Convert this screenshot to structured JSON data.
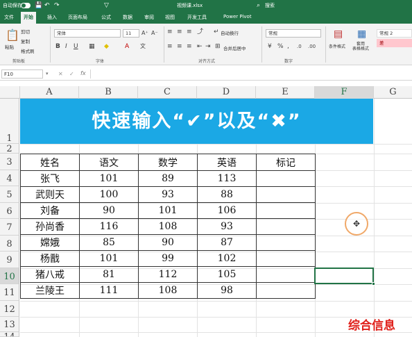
{
  "titlebar": {
    "autosave_label": "自动保存",
    "filename": "视频课.xlsx",
    "search_placeholder": "搜索"
  },
  "tabs": [
    "文件",
    "开始",
    "插入",
    "页面布局",
    "公式",
    "数据",
    "审阅",
    "视图",
    "开发工具",
    "Power Pivot"
  ],
  "active_tab": "开始",
  "ribbon": {
    "paste": "粘贴",
    "cut": "剪切",
    "copy": "复制",
    "format_painter": "格式刷",
    "font_name": "宋体",
    "font_size": "11",
    "wrap_text": "自动换行",
    "merge_center": "合并后居中",
    "number_format": "常规",
    "conditional_format": "条件格式",
    "table_format": "套用\n表格格式",
    "style_normal": "常规 2",
    "style_bad": "差",
    "groups": {
      "clipboard": "剪贴板",
      "font": "字体",
      "alignment": "对齐方式",
      "number": "数字"
    }
  },
  "formula_bar": {
    "name_box": "F10",
    "formula": ""
  },
  "columns": [
    "A",
    "B",
    "C",
    "D",
    "E",
    "F",
    "G"
  ],
  "rows": [
    "1",
    "2",
    "3",
    "4",
    "5",
    "6",
    "7",
    "8",
    "9",
    "10",
    "11",
    "12",
    "13",
    "14"
  ],
  "banner_text": "快速输入“✔”以及“✖”",
  "table": {
    "headers": [
      "姓名",
      "语文",
      "数学",
      "英语",
      "标记"
    ],
    "rows": [
      [
        "张飞",
        "101",
        "89",
        "113",
        ""
      ],
      [
        "武则天",
        "100",
        "93",
        "88",
        ""
      ],
      [
        "刘备",
        "90",
        "101",
        "106",
        ""
      ],
      [
        "孙尚香",
        "116",
        "108",
        "93",
        ""
      ],
      [
        "嫦娥",
        "85",
        "90",
        "87",
        ""
      ],
      [
        "杨戬",
        "101",
        "99",
        "102",
        ""
      ],
      [
        "猪八戒",
        "81",
        "112",
        "105",
        ""
      ],
      [
        "兰陵王",
        "111",
        "108",
        "98",
        ""
      ]
    ]
  },
  "watermark": "综合信息",
  "colors": {
    "excel_green": "#217346",
    "banner_blue": "#1ba8e5",
    "watermark_red": "#e0201a"
  }
}
